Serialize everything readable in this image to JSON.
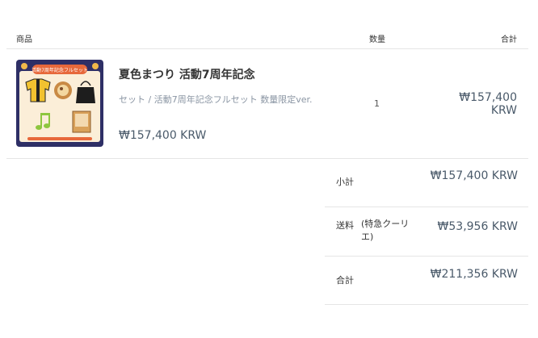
{
  "table_header": {
    "product": "商品",
    "quantity": "数量",
    "total": "合計"
  },
  "item": {
    "thumbnail_banner": "活動7周年記念フルセット",
    "name": "夏色まつり 活動7周年記念",
    "variant": "セット / 活動7周年記念フルセット 数量限定ver.",
    "price": "₩157,400 KRW",
    "quantity": "1",
    "line_total": "₩157,400 KRW"
  },
  "summary": {
    "subtotal_label": "小計",
    "subtotal_value": "₩157,400 KRW",
    "shipping_label": "送料",
    "shipping_method": "(特急クーリエ)",
    "shipping_value": "₩53,956 KRW",
    "total_label": "合計",
    "total_value": "₩211,356 KRW"
  }
}
